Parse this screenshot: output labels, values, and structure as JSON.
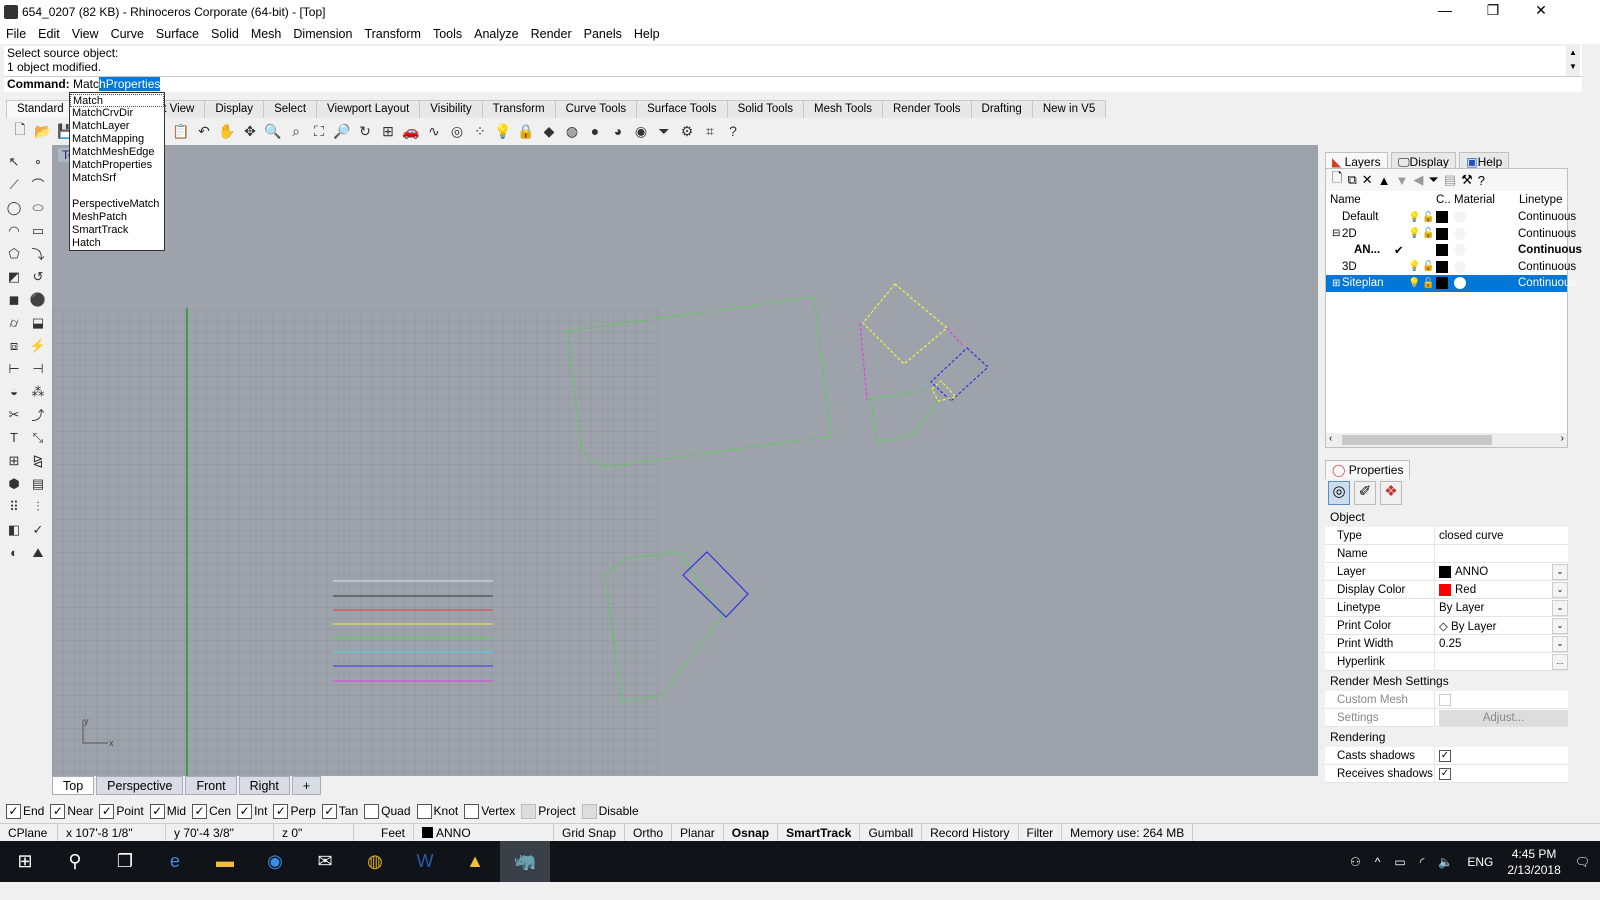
{
  "window": {
    "title": "654_0207 (82 KB) - Rhinoceros Corporate (64-bit) - [Top]",
    "controls": [
      "—",
      "❐",
      "✕"
    ]
  },
  "menu": [
    "File",
    "Edit",
    "View",
    "Curve",
    "Surface",
    "Solid",
    "Mesh",
    "Dimension",
    "Transform",
    "Tools",
    "Analyze",
    "Render",
    "Panels",
    "Help"
  ],
  "command": {
    "history": [
      "Select source object:",
      "1 object modified."
    ],
    "prompt": "Command:",
    "typed": "Matc",
    "autocomplete": "hProperties"
  },
  "autocomplete_list": [
    "Match",
    "MatchCrvDir",
    "MatchLayer",
    "MatchMapping",
    "MatchMeshEdge",
    "MatchProperties",
    "MatchSrf",
    "",
    "PerspectiveMatch",
    "MeshPatch",
    "SmartTrack",
    "Hatch"
  ],
  "toolbar_tabs": [
    "Standard",
    "CPlanes",
    "Set View",
    "Display",
    "Select",
    "Viewport Layout",
    "Visibility",
    "Transform",
    "Curve Tools",
    "Surface Tools",
    "Solid Tools",
    "Mesh Tools",
    "Render Tools",
    "Drafting",
    "New in V5"
  ],
  "toolbar_icons": [
    [
      "new-icon",
      "🗋"
    ],
    [
      "open-icon",
      "📂"
    ],
    [
      "save-icon",
      "💾"
    ],
    [
      "print-icon",
      "🖶"
    ],
    [
      "import-icon",
      "⇲"
    ],
    [
      "cut-icon",
      "✂"
    ],
    [
      "copy-icon",
      "⎘"
    ],
    [
      "paste-icon",
      "📋"
    ],
    [
      "undo-icon",
      "↶"
    ],
    [
      "pan-icon",
      "✋"
    ],
    [
      "rotate-view-icon",
      "✥"
    ],
    [
      "zoom-window-icon",
      "🔍"
    ],
    [
      "zoom-dynamic-icon",
      "⌕"
    ],
    [
      "zoom-extents-icon",
      "⛶"
    ],
    [
      "zoom-selected-icon",
      "🔎"
    ],
    [
      "rotate-camera-icon",
      "↻"
    ],
    [
      "four-viewports-icon",
      "⊞"
    ],
    [
      "car-icon",
      "🚗"
    ],
    [
      "curve-icon",
      "∿"
    ],
    [
      "cplane-icon",
      "◎"
    ],
    [
      "points-icon",
      "⁘"
    ],
    [
      "light-icon",
      "💡"
    ],
    [
      "lock-icon",
      "🔒"
    ],
    [
      "layer-icon",
      "◆"
    ],
    [
      "color-wheel-icon",
      "◍"
    ],
    [
      "render-sphere-icon",
      "●"
    ],
    [
      "shaded-sphere-icon",
      "◕"
    ],
    [
      "rendered-sphere-icon",
      "◉"
    ],
    [
      "filter-icon",
      "⏷"
    ],
    [
      "settings-icon",
      "⚙"
    ],
    [
      "snap-icon",
      "⌗"
    ],
    [
      "help-icon",
      "?"
    ]
  ],
  "left_icons": [
    [
      "select-icon",
      "↖"
    ],
    [
      "point-icon",
      "∘"
    ],
    [
      "polyline-icon",
      "⟋"
    ],
    [
      "curve-cv-icon",
      "⌒"
    ],
    [
      "circle-icon",
      "◯"
    ],
    [
      "ellipse-icon",
      "⬭"
    ],
    [
      "arc-icon",
      "◠"
    ],
    [
      "rectangle-icon",
      "▭"
    ],
    [
      "polygon-icon",
      "⬠"
    ],
    [
      "fillet-icon",
      "⤵"
    ],
    [
      "surface-icon",
      "◩"
    ],
    [
      "revolve-icon",
      "↺"
    ],
    [
      "box-icon",
      "◼"
    ],
    [
      "sphere-icon",
      "⚫"
    ],
    [
      "cylinder-icon",
      "⌭"
    ],
    [
      "extrude-icon",
      "⬓"
    ],
    [
      "mesh-icon",
      "⧈"
    ],
    [
      "boolean-icon",
      "⚡"
    ],
    [
      "dimension-icon",
      "⊢"
    ],
    [
      "leader-icon",
      "⊣"
    ],
    [
      "group-icon",
      "◒"
    ],
    [
      "ungroup-icon",
      "⁂"
    ],
    [
      "trim-icon",
      "✂"
    ],
    [
      "split-icon",
      "⤴"
    ],
    [
      "text-icon",
      "T"
    ],
    [
      "scale-icon",
      "⤡"
    ],
    [
      "array-icon",
      "⊞"
    ],
    [
      "mirror-icon",
      "⧎"
    ],
    [
      "block-icon",
      "⬢"
    ],
    [
      "layout-icon",
      "▤"
    ],
    [
      "grid-array-icon",
      "⠿"
    ],
    [
      "align-icon",
      "⫶"
    ],
    [
      "analyze-icon",
      "◧"
    ],
    [
      "check-icon",
      "✓"
    ],
    [
      "render-icon",
      "◐"
    ],
    [
      "paint-icon",
      "⛰"
    ]
  ],
  "viewport": {
    "label": "Top",
    "tabs": [
      "Top",
      "Perspective",
      "Front",
      "Right"
    ],
    "add_tab": "+",
    "axis_x": "x",
    "axis_y": "y"
  },
  "osnap": [
    {
      "label": "End",
      "checked": true
    },
    {
      "label": "Near",
      "checked": true
    },
    {
      "label": "Point",
      "checked": true
    },
    {
      "label": "Mid",
      "checked": true
    },
    {
      "label": "Cen",
      "checked": true
    },
    {
      "label": "Int",
      "checked": true
    },
    {
      "label": "Perp",
      "checked": true
    },
    {
      "label": "Tan",
      "checked": true
    },
    {
      "label": "Quad",
      "checked": false
    },
    {
      "label": "Knot",
      "checked": false
    },
    {
      "label": "Vertex",
      "checked": false
    },
    {
      "label": "Project",
      "checked": false,
      "disabled": true
    },
    {
      "label": "Disable",
      "checked": false,
      "disabled": true
    }
  ],
  "status": {
    "cplane": "CPlane",
    "x": "x 107'-8 1/8\"",
    "y": "y 70'-4 3/8\"",
    "z": "z 0\"",
    "units": "Feet",
    "layer": "ANNO",
    "toggles": [
      {
        "label": "Grid Snap",
        "on": false
      },
      {
        "label": "Ortho",
        "on": false
      },
      {
        "label": "Planar",
        "on": false
      },
      {
        "label": "Osnap",
        "on": true
      },
      {
        "label": "SmartTrack",
        "on": true
      },
      {
        "label": "Gumball",
        "on": false
      },
      {
        "label": "Record History",
        "on": false
      },
      {
        "label": "Filter",
        "on": false
      }
    ],
    "memory": "Memory use: 264 MB"
  },
  "layers": {
    "tabs": [
      "Layers",
      "Display",
      "Help"
    ],
    "columns": [
      "Name",
      "C..",
      "Material",
      "Linetype"
    ],
    "rows": [
      {
        "name": "Default",
        "linetype": "Continuous",
        "bold": false,
        "selected": false,
        "expander": ""
      },
      {
        "name": "2D",
        "linetype": "Continuous",
        "bold": false,
        "selected": false,
        "expander": "⊟"
      },
      {
        "name": "AN...",
        "linetype": "Continuous",
        "bold": true,
        "selected": false,
        "expander": "",
        "current": "✔"
      },
      {
        "name": "3D",
        "linetype": "Continuous",
        "bold": false,
        "selected": false,
        "expander": ""
      },
      {
        "name": "Siteplan",
        "linetype": "Continuous",
        "bold": false,
        "selected": true,
        "expander": "⊞"
      }
    ]
  },
  "properties": {
    "tab": "Properties",
    "sections": {
      "object": "Object",
      "render_mesh": "Render Mesh Settings",
      "rendering": "Rendering"
    },
    "object": [
      {
        "k": "Type",
        "v": "closed curve"
      },
      {
        "k": "Name",
        "v": ""
      },
      {
        "k": "Layer",
        "v": "ANNO",
        "swatch": "#000000",
        "dd": true
      },
      {
        "k": "Display Color",
        "v": "Red",
        "swatch": "#ff0000",
        "dd": true
      },
      {
        "k": "Linetype",
        "v": "By Layer",
        "dd": true
      },
      {
        "k": "Print Color",
        "v": "◇ By Layer",
        "dd": true
      },
      {
        "k": "Print Width",
        "v": "0.25",
        "dd": true
      },
      {
        "k": "Hyperlink",
        "v": "",
        "more": "..."
      }
    ],
    "render_mesh": [
      {
        "k": "Custom Mesh",
        "checkbox": false
      },
      {
        "k": "Settings",
        "button": "Adjust..."
      }
    ],
    "rendering": [
      {
        "k": "Casts shadows",
        "checkbox": true
      },
      {
        "k": "Receives shadows",
        "checkbox": true
      }
    ]
  },
  "taskbar": {
    "time": "4:45 PM",
    "date": "2/13/2018",
    "lang": "ENG"
  },
  "colors": {
    "accent": "#0078d7",
    "viewport_bg": "#9ea3ab",
    "grid": "#8a8f97"
  }
}
